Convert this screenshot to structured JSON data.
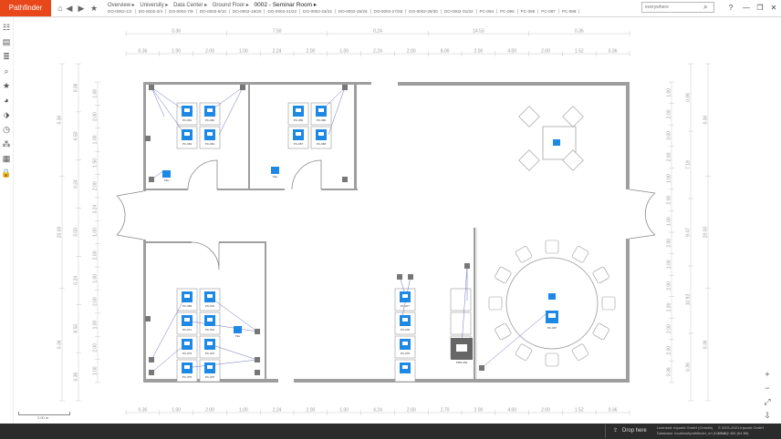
{
  "app": {
    "logo": "Pathfinder"
  },
  "nav": {
    "home_icon": "home-icon",
    "back_icon": "arrow-left-icon",
    "forward_icon": "arrow-right-icon",
    "bookmark_icon": "star-icon"
  },
  "breadcrumb": [
    "Overview ▸",
    "University ▸",
    "Data Center ▸",
    "Ground Floor ▸",
    "0002 - Seminar Room ▸"
  ],
  "tabs": [
    "DO-0002-1/2",
    "DO-0002-3/4",
    "DO-0002-7/8",
    "DO-0002-9/10",
    "DO-0002-19/20",
    "DO-0002-21/22",
    "DO-0002-23/24",
    "DO-0002-25/26",
    "DO-0002-27/28",
    "DO-0002-29/30",
    "DO-0002-31/32",
    "PC-094",
    "PC-095",
    "PC-096",
    "PC-097",
    "PC-098"
  ],
  "search": {
    "placeholder": "everywhere"
  },
  "window": {
    "help": "?",
    "minimize": "—",
    "restore": "❐",
    "close": "✕"
  },
  "plan": {
    "dims_top1": [
      "0.36",
      "7.50",
      "0.24",
      "14.53",
      "0.36"
    ],
    "dims_top2": [
      "0.36",
      "1.00",
      "2.00",
      "1.00",
      "2.24",
      "2.00",
      "1.00",
      "2.24",
      "2.00",
      "8.00",
      "2.00",
      "4.00",
      "2.00",
      "1.52",
      "0.36"
    ],
    "dims_bottom": [
      "0.36",
      "1.00",
      "2.00",
      "1.00",
      "2.24",
      "2.00",
      "1.00",
      "4.24",
      "2.00",
      "2.70",
      "2.00",
      "4.00",
      "2.00",
      "1.52",
      "0.36"
    ],
    "dims_left_outer": [
      "0.36",
      "20.00",
      "0.36"
    ],
    "dims_left_mid": [
      "0.36",
      "6.50",
      "0.24",
      "3.00",
      "0.24",
      "8.50",
      "0.36"
    ],
    "dims_left_inner": [
      "1.00",
      "2.00",
      "1.00",
      "1.50",
      "2.00",
      "3.24",
      "1.00",
      "2.00",
      "1.00",
      "2.00",
      "1.00",
      "2.00",
      "1.00"
    ],
    "dims_right_outer": [
      "0.36",
      "20.00",
      "0.36"
    ],
    "dims_right_mid": [
      "0.36",
      "7.18",
      "9.47",
      "10.93",
      "0.36"
    ],
    "dims_right_inner": [
      "1.00",
      "2.00",
      "3.00",
      "2.00",
      "1.00",
      "2.00",
      "1.00",
      "2.00",
      "1.00",
      "2.00",
      "1.00",
      "2.00",
      "2.00",
      "0.36"
    ],
    "pcs_tl": [
      "PC-061",
      "PC-062",
      "PC-063",
      "PC-064"
    ],
    "pcs_tm": [
      "PC-065",
      "PC-066",
      "PC-067",
      "PC-068"
    ],
    "pcs_bl": [
      "PC-069",
      "PC-070",
      "PC-071",
      "PC-072",
      "PC-073",
      "PC-074",
      "PC-075",
      "PC-076"
    ],
    "pcs_bm": [
      "PC-077",
      "PC-078",
      "PC-079"
    ],
    "pc_round": "PC-097",
    "printer": "PRN-003",
    "phones": [
      "TEL",
      "TEL",
      "TEL",
      "TEL",
      "TEL"
    ]
  },
  "zoom": {
    "in": "+",
    "out": "−",
    "fit": "⤢",
    "export": "⇩"
  },
  "scale": {
    "label": "2.00 m"
  },
  "footer": {
    "drop": "Drop here",
    "license1": "Licensed: tripunkt GmbH (Christin)",
    "license2": "Database: localhost\\pathfinder_en (DZ8 db)",
    "copy1": "© 2001-2021 tripunkt GmbH",
    "copy2": "v.8.2.2.456 (64 Bit)"
  },
  "colors": {
    "accent": "#e8471a",
    "pc": "#1e88e5",
    "wall": "#9e9e9e",
    "footer": "#2b2b2b"
  }
}
